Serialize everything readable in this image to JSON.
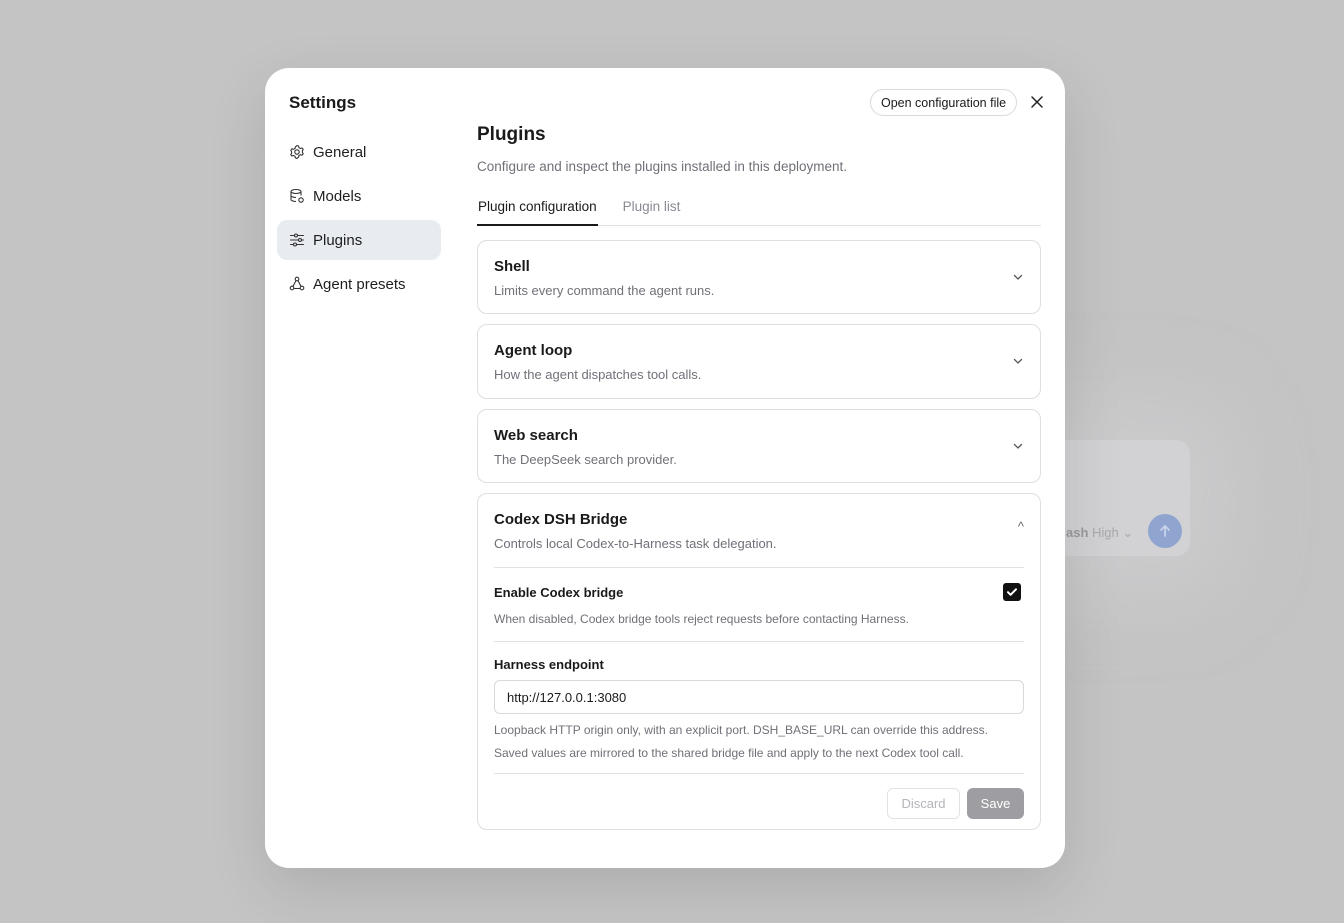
{
  "background": {
    "model_label": "ash",
    "model_level": "High"
  },
  "modal": {
    "title": "Settings",
    "open_config_label": "Open configuration file",
    "nav": [
      {
        "label": "General",
        "icon": "gear-icon"
      },
      {
        "label": "Models",
        "icon": "database-icon"
      },
      {
        "label": "Plugins",
        "icon": "sliders-icon",
        "active": true
      },
      {
        "label": "Agent presets",
        "icon": "network-icon"
      }
    ]
  },
  "plugins": {
    "heading": "Plugins",
    "subheading": "Configure and inspect the plugins installed in this deployment.",
    "tabs": [
      {
        "label": "Plugin configuration",
        "active": true
      },
      {
        "label": "Plugin list",
        "active": false
      }
    ],
    "cards": [
      {
        "title": "Shell",
        "description": "Limits every command the agent runs.",
        "expanded": false
      },
      {
        "title": "Agent loop",
        "description": "How the agent dispatches tool calls.",
        "expanded": false
      },
      {
        "title": "Web search",
        "description": "The DeepSeek search provider.",
        "expanded": false
      },
      {
        "title": "Codex DSH Bridge",
        "description": "Controls local Codex-to-Harness task delegation.",
        "expanded": true,
        "chevron": "^"
      }
    ],
    "bridge": {
      "enable_label": "Enable Codex bridge",
      "enable_help": "When disabled, Codex bridge tools reject requests before contacting Harness.",
      "enabled": true,
      "endpoint_label": "Harness endpoint",
      "endpoint_value": "http://127.0.0.1:3080",
      "endpoint_help_1": "Loopback HTTP origin only, with an explicit port. DSH_BASE_URL can override this address.",
      "endpoint_help_2": "Saved values are mirrored to the shared bridge file and apply to the next Codex tool call.",
      "discard_label": "Discard",
      "save_label": "Save"
    }
  },
  "colors": {
    "overlay": "#c4c4c4",
    "active_nav": "#e8ebf0",
    "save_button": "#9e9ea2",
    "muted_text": "#707078"
  }
}
